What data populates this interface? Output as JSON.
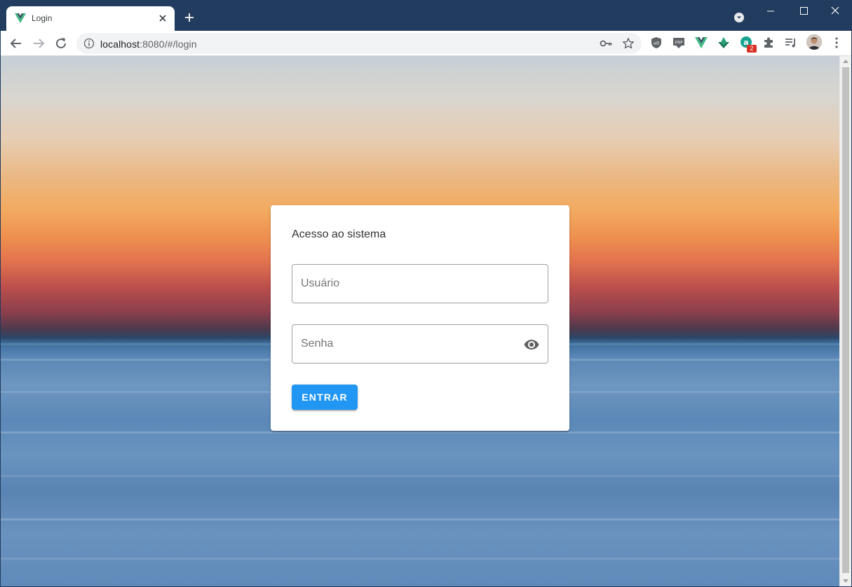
{
  "browser": {
    "tab_title": "Login",
    "url_host": "localhost",
    "url_rest": ":8080/#/login",
    "extension_badge": "2",
    "icons": [
      "vue-favicon-icon",
      "close-icon",
      "plus-icon",
      "tab-search-icon",
      "minimize-icon",
      "maximize-icon",
      "window-close-icon",
      "back-icon",
      "forward-icon",
      "reload-icon",
      "info-icon",
      "key-icon",
      "star-icon",
      "ublock-icon",
      "dsp-icon",
      "vue-devtools-icon",
      "download-ext-icon",
      "grammar-ext-icon",
      "puzzle-icon",
      "reading-list-icon",
      "profile-avatar",
      "menu-dots-icon"
    ]
  },
  "login": {
    "title": "Acesso ao sistema",
    "username_placeholder": "Usuário",
    "password_placeholder": "Senha",
    "submit_label": "ENTRAR"
  },
  "colors": {
    "titlebar": "#213c5e",
    "button": "#2196f3",
    "card": "#ffffff"
  }
}
